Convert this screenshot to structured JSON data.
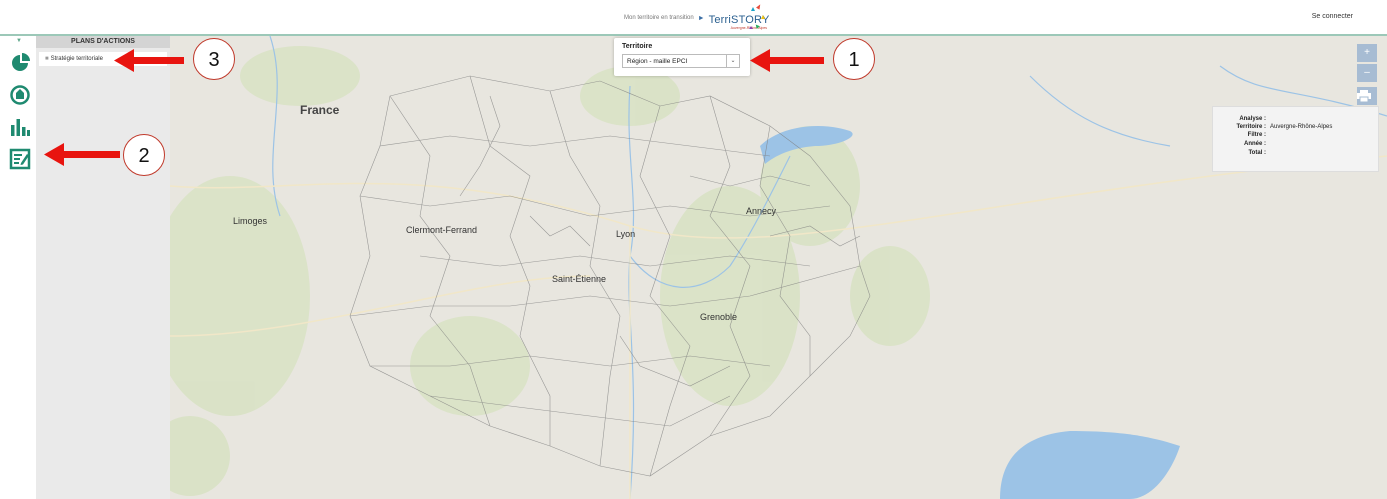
{
  "header": {
    "tagline": "Mon territoire en transition",
    "logo_text": "TerriSTORY",
    "logo_sub": "Auvergne-Rhône-Alpes",
    "login_label": "Se connecter"
  },
  "sidebar": {
    "icons": [
      "pie-chart-icon",
      "location-pin-icon",
      "bar-chart-icon",
      "action-plan-icon"
    ]
  },
  "panel": {
    "title": "PLANS D'ACTIONS",
    "items": [
      {
        "label": "Stratégie territoriale"
      }
    ]
  },
  "territory": {
    "label": "Territoire",
    "selected": "Région - maille EPCI"
  },
  "map": {
    "country": "France",
    "cities": [
      "Limoges",
      "Clermont-Ferrand",
      "Lyon",
      "Annecy",
      "Saint-Étienne",
      "Grenoble"
    ],
    "zoom_in": "+",
    "zoom_out": "–"
  },
  "info": {
    "analyse_label": "Analyse :",
    "territoire_label": "Territoire :",
    "territoire_value": "Auvergne-Rhône-Alpes",
    "filtre_label": "Filtre :",
    "annee_label": "Année :",
    "total_label": "Total :"
  },
  "annotations": [
    "1",
    "2",
    "3"
  ],
  "colors": {
    "accent": "#1f8a70",
    "arrow": "#e8140f",
    "water": "#9cc3e6",
    "forest": "#c6dba5"
  }
}
